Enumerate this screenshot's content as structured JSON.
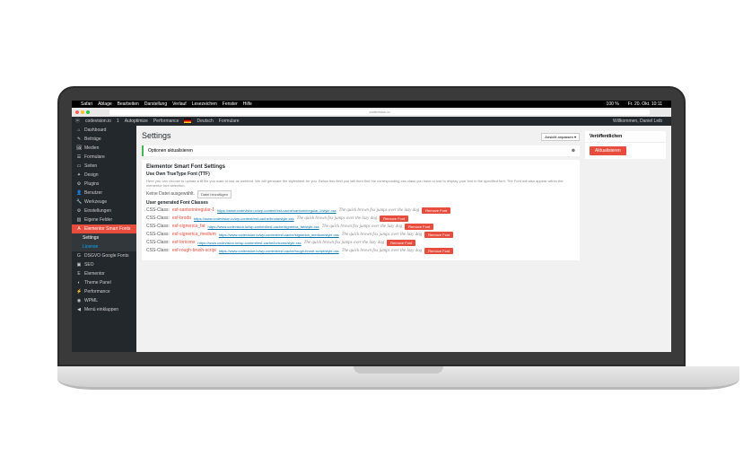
{
  "menubar": {
    "app": "Safari",
    "items": [
      "Ablage",
      "Bearbeiten",
      "Darstellung",
      "Verlauf",
      "Lesezeichen",
      "Fenster",
      "Hilfe"
    ],
    "clock": "Fr. 20. Okt. 10:11",
    "wifi": "100 %"
  },
  "browser": {
    "url": "codevision.io"
  },
  "wpbar": {
    "site": "codevision.io",
    "updates": "1",
    "autopt": "Autoptimize",
    "perf": "Performance",
    "lang": "Deutsch",
    "forms": "Formulare",
    "welcome": "Willkommen, Daniel Leib"
  },
  "sidebar": {
    "items": [
      {
        "icon": "⌂",
        "label": "Dashboard"
      },
      {
        "icon": "✎",
        "label": "Beiträge"
      },
      {
        "icon": "🖼",
        "label": "Medien"
      },
      {
        "icon": "☰",
        "label": "Formulare"
      },
      {
        "icon": "▭",
        "label": "Seiten"
      },
      {
        "icon": "✦",
        "label": "Design"
      },
      {
        "icon": "⚙",
        "label": "Plugins"
      },
      {
        "icon": "👤",
        "label": "Benutzer"
      },
      {
        "icon": "🔧",
        "label": "Werkzeuge"
      },
      {
        "icon": "⚙",
        "label": "Einstellungen"
      },
      {
        "icon": "▥",
        "label": "Eigene Felder"
      },
      {
        "icon": "A",
        "label": "Elementor Smart Fonts",
        "active": true
      },
      {
        "icon": "",
        "label": "Settings",
        "sub": true,
        "hl": true
      },
      {
        "icon": "",
        "label": "License",
        "sub": true
      },
      {
        "icon": "G",
        "label": "DSGVO Google Fonts"
      },
      {
        "icon": "▣",
        "label": "SEO"
      },
      {
        "icon": "E",
        "label": "Elementor"
      },
      {
        "icon": "◐",
        "label": "Theme Panel"
      },
      {
        "icon": "⚡",
        "label": "Performance"
      },
      {
        "icon": "◉",
        "label": "WPML"
      },
      {
        "icon": "◀",
        "label": "Menü einklappen"
      }
    ]
  },
  "page": {
    "title": "Settings",
    "notice": "Optionen aktualisieren",
    "screenOpts": "Ansicht anpassen ▾",
    "cardTitle": "Elementor Smart Font Settings",
    "uploadTitle": "Use Own TrueType Font (TTF)",
    "uploadDesc": "Here you can choose to upload a ttf file you want to use as webfont. We will generate the stylesheet for you. Below this field you will then find the corresponding css-class you have to use to display your font in the specified font. The Font will also appear within the elementor font selection.",
    "noFile": "Keine Datei ausgewählt.",
    "fileBtn": "Datei hinzufügen",
    "classesTitle": "User generated Font Classes",
    "cssLabel": "CSS-Class:",
    "removeBtn": "Remove Font",
    "sample": "The quick brown fox jumps over the lazy dog",
    "fonts": [
      {
        "cls": "esf-santoriniregular-1",
        "url": "https://www.codevision.io/wp-content/esf-cache/santoriniregular-1/style.css"
      },
      {
        "cls": "esf-broda",
        "url": "https://www.codevision.io/wp-content/esf-cache/broda/style.css"
      },
      {
        "cls": "esf-signerica_fat",
        "url": "https://www.codevision.io/wp-content/esf-cache/signerica_fat/style.css"
      },
      {
        "cls": "esf-signerica_medium",
        "url": "https://www.codevision.io/wp-content/esf-cache/signerica_medium/style.css"
      },
      {
        "cls": "esf-loricons",
        "url": "https://www.codevision.io/wp-content/esf-cache/loricons/style.css"
      },
      {
        "cls": "esf-rough-brush-script",
        "url": "https://www.codevision.io/wp-content/esf-cache/rough-brush-script/style.css"
      }
    ],
    "publish": {
      "title": "Veröffentlichen",
      "btn": "Aktualisieren"
    }
  }
}
